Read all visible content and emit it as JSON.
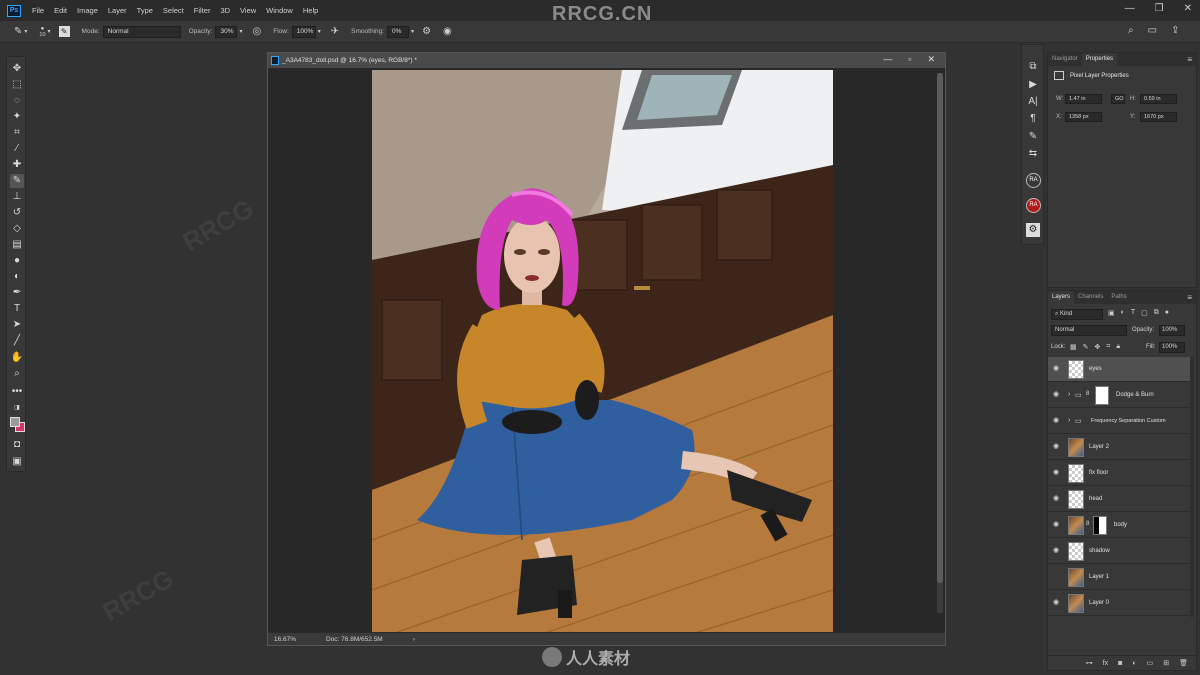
{
  "menubar": {
    "app_icon": "Ps",
    "items": [
      "File",
      "Edit",
      "Image",
      "Layer",
      "Type",
      "Select",
      "Filter",
      "3D",
      "View",
      "Window",
      "Help"
    ],
    "watermark": "RRCG.CN"
  },
  "options_bar": {
    "brush_size": "10",
    "mode_label": "Mode:",
    "mode_value": "Normal",
    "opacity_label": "Opacity:",
    "opacity_value": "30%",
    "flow_label": "Flow:",
    "flow_value": "100%",
    "smoothing_label": "Smoothing:",
    "smoothing_value": "0%"
  },
  "document": {
    "title": "_A3A4783_doll.psd @ 16.7% (eyes, RGB/8*) *",
    "zoom": "16.67%",
    "doc_size": "Doc: 76.8M/652.5M"
  },
  "properties_panel": {
    "tabs": [
      "Navigator",
      "Properties"
    ],
    "active_tab": "Properties",
    "heading": "Pixel Layer Properties",
    "w_label": "W:",
    "w_value": "1.47 in",
    "link_label": "GO",
    "h_label": "H:",
    "h_value": "0.59 in",
    "x_label": "X:",
    "x_value": "1358 px",
    "y_label": "Y:",
    "y_value": "1670 px"
  },
  "layers_panel": {
    "tabs": [
      "Layers",
      "Channels",
      "Paths"
    ],
    "active_tab": "Layers",
    "filter_value": "Kind",
    "blend_mode": "Normal",
    "opacity_label": "Opacity:",
    "opacity_value": "100%",
    "lock_label": "Lock:",
    "fill_label": "Fill:",
    "fill_value": "100%",
    "layers": [
      {
        "name": "eyes",
        "thumb": "checker",
        "visible": true,
        "selected": true
      },
      {
        "name": "Dodge & Burn",
        "thumb": "folder",
        "visible": true,
        "selected": false
      },
      {
        "name": "Frequency Separation Custom",
        "thumb": "folder",
        "visible": true,
        "selected": false
      },
      {
        "name": "Layer 2",
        "thumb": "photo",
        "visible": true,
        "selected": false
      },
      {
        "name": "fix floor",
        "thumb": "checker",
        "visible": true,
        "selected": false
      },
      {
        "name": "head",
        "thumb": "checker",
        "visible": true,
        "selected": false
      },
      {
        "name": "body",
        "thumb": "photo-mask",
        "visible": true,
        "selected": false
      },
      {
        "name": "shadow",
        "thumb": "checker",
        "visible": true,
        "selected": false
      },
      {
        "name": "Layer 1",
        "thumb": "photo",
        "visible": false,
        "selected": false
      },
      {
        "name": "Layer 0",
        "thumb": "photo",
        "visible": true,
        "selected": false
      }
    ]
  },
  "bottom_watermark": "人人素材",
  "colors": {
    "ps_blue": "#31a8ff",
    "foreground_swatch": "#9a9a9a",
    "background_swatch": "#d6336c",
    "hair_pink": "#d23bb9",
    "shirt_mustard": "#c8862a",
    "skirt_denim": "#2f5f9e",
    "floor_wood": "#b57a3c"
  }
}
